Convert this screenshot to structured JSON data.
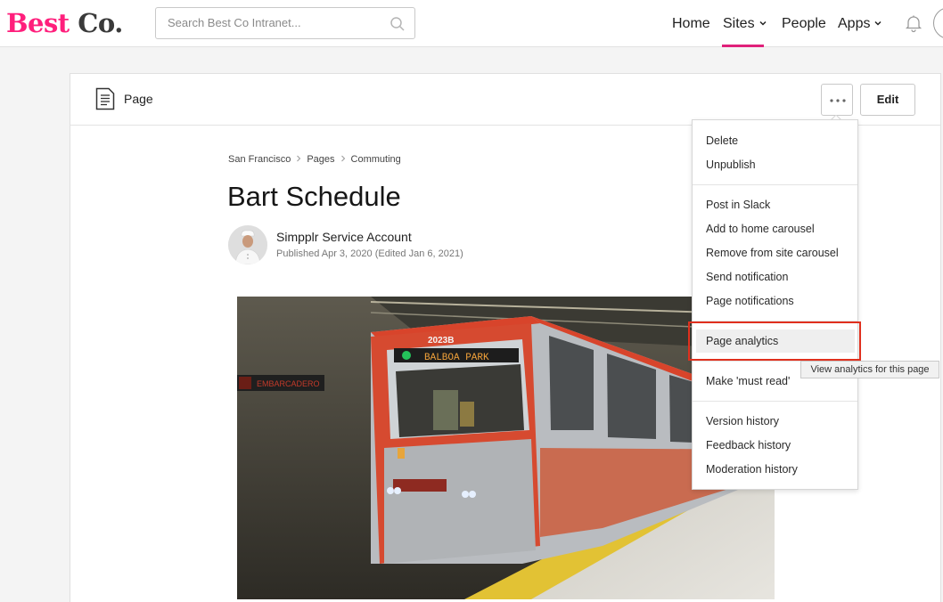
{
  "brand": {
    "logo_part1": "Best",
    "logo_part2": "Co."
  },
  "search": {
    "placeholder": "Search Best Co Intranet..."
  },
  "nav": {
    "home": "Home",
    "sites": "Sites",
    "people": "People",
    "apps": "Apps",
    "active": "Sites"
  },
  "page_header": {
    "type_label": "Page",
    "edit_label": "Edit"
  },
  "breadcrumb": [
    "San Francisco",
    "Pages",
    "Commuting"
  ],
  "article": {
    "title": "Bart Schedule",
    "author": "Simpplr Service Account",
    "meta": "Published Apr 3, 2020 (Edited Jan 6, 2021)"
  },
  "menu": {
    "group1": [
      "Delete",
      "Unpublish"
    ],
    "group2": [
      "Post in Slack",
      "Add to home carousel",
      "Remove from site carousel",
      "Send notification",
      "Page notifications"
    ],
    "group3": [
      "Page analytics"
    ],
    "group4": [
      "Make 'must read'"
    ],
    "group5": [
      "Version history",
      "Feedback history",
      "Moderation history"
    ],
    "highlighted": "Page analytics"
  },
  "tooltip": "View analytics for this page",
  "colors": {
    "brand_pink": "#ff1f7c",
    "nav_underline": "#e0207a",
    "highlight_box": "#e0301e"
  }
}
